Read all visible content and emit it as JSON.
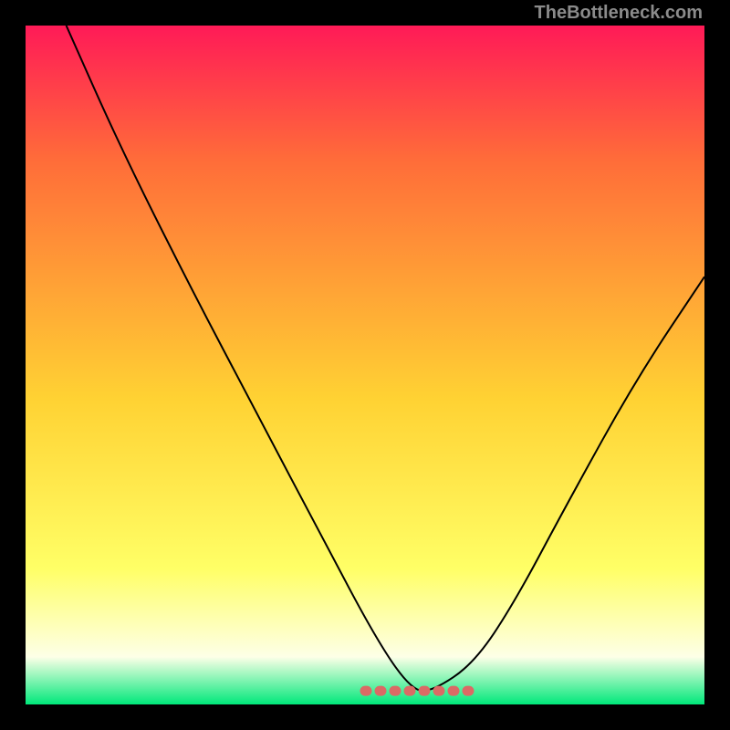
{
  "credit": "TheBottleneck.com",
  "colors": {
    "background_black": "#000000",
    "gradient_top": "#ff1a57",
    "gradient_mid_upper": "#ff6d39",
    "gradient_mid": "#ffd233",
    "gradient_mid_lower": "#ffff66",
    "gradient_near_bottom": "#fdffe7",
    "gradient_bottom": "#00e87a",
    "curve": "#000000",
    "dash": "#db6a65"
  },
  "chart_data": {
    "type": "line",
    "title": "",
    "xlabel": "",
    "ylabel": "",
    "xlim": [
      0,
      1
    ],
    "ylim": [
      0,
      1
    ],
    "series": [
      {
        "name": "v-curve",
        "x": [
          0.06,
          0.14,
          0.24,
          0.34,
          0.44,
          0.52,
          0.57,
          0.6,
          0.66,
          0.72,
          0.8,
          0.9,
          1.0
        ],
        "y": [
          1.0,
          0.82,
          0.62,
          0.43,
          0.24,
          0.09,
          0.02,
          0.02,
          0.06,
          0.15,
          0.3,
          0.48,
          0.63
        ]
      }
    ],
    "bottom_dash": {
      "x_start": 0.5,
      "x_end": 0.66,
      "y": 0.02
    },
    "gradient_stops": [
      {
        "offset": 0.0,
        "hex": "#ff1a57"
      },
      {
        "offset": 0.2,
        "hex": "#ff6d39"
      },
      {
        "offset": 0.55,
        "hex": "#ffd233"
      },
      {
        "offset": 0.8,
        "hex": "#ffff66"
      },
      {
        "offset": 0.93,
        "hex": "#fdffe7"
      },
      {
        "offset": 1.0,
        "hex": "#00e87a"
      }
    ]
  }
}
